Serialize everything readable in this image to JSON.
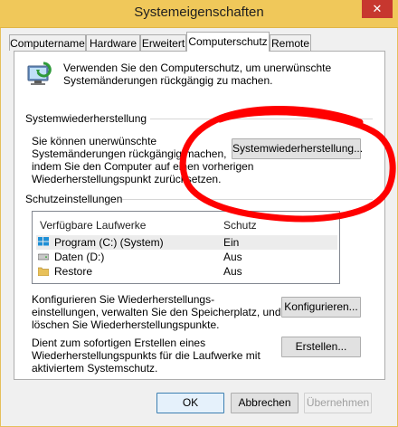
{
  "window": {
    "title": "Systemeigenschaften",
    "close_glyph": "✕"
  },
  "tabs": [
    {
      "label": "Computername",
      "active": false
    },
    {
      "label": "Hardware",
      "active": false
    },
    {
      "label": "Erweitert",
      "active": false
    },
    {
      "label": "Computerschutz",
      "active": true
    },
    {
      "label": "Remote",
      "active": false
    }
  ],
  "intro": {
    "icon": "computer-protection-icon",
    "text": "Verwenden Sie den Computerschutz, um unerwünschte Systemänderungen rückgängig zu machen."
  },
  "restore": {
    "heading": "Systemwiederherstellung",
    "description_lines": [
      "Sie können unerwünschte",
      "Systemänderungen rückgängig machen,",
      "indem Sie den Computer auf einen vorherigen",
      "Wiederherstellungspunkt zurücksetzen."
    ],
    "button_label": "Systemwiederherstellung..."
  },
  "protection": {
    "heading": "Schutzeinstellungen",
    "columns": [
      "Verfügbare Laufwerke",
      "Schutz"
    ],
    "drives": [
      {
        "name": "Program (C:) (System)",
        "status": "Ein",
        "icon": "windows-drive-icon",
        "selected": true
      },
      {
        "name": "Daten (D:)",
        "status": "Aus",
        "icon": "drive-icon",
        "selected": false
      },
      {
        "name": "Restore",
        "status": "Aus",
        "icon": "folder-icon",
        "selected": false
      }
    ]
  },
  "configure": {
    "text_lines": [
      "Konfigurieren Sie Wiederherstellungs-",
      "einstellungen, verwalten Sie den Speicherplatz, und",
      "löschen Sie Wiederherstellungspunkte."
    ],
    "button_label": "Konfigurieren..."
  },
  "create": {
    "text_lines": [
      "Dient zum sofortigen Erstellen eines",
      "Wiederherstellungspunkts für die Laufwerke mit",
      "aktiviertem Systemschutz."
    ],
    "button_label": "Erstellen..."
  },
  "footer": {
    "ok_label": "OK",
    "cancel_label": "Abbrechen",
    "apply_label": "Übernehmen"
  },
  "annotation": {
    "shape": "red-hand-drawn-circle",
    "color": "#ff0000"
  }
}
